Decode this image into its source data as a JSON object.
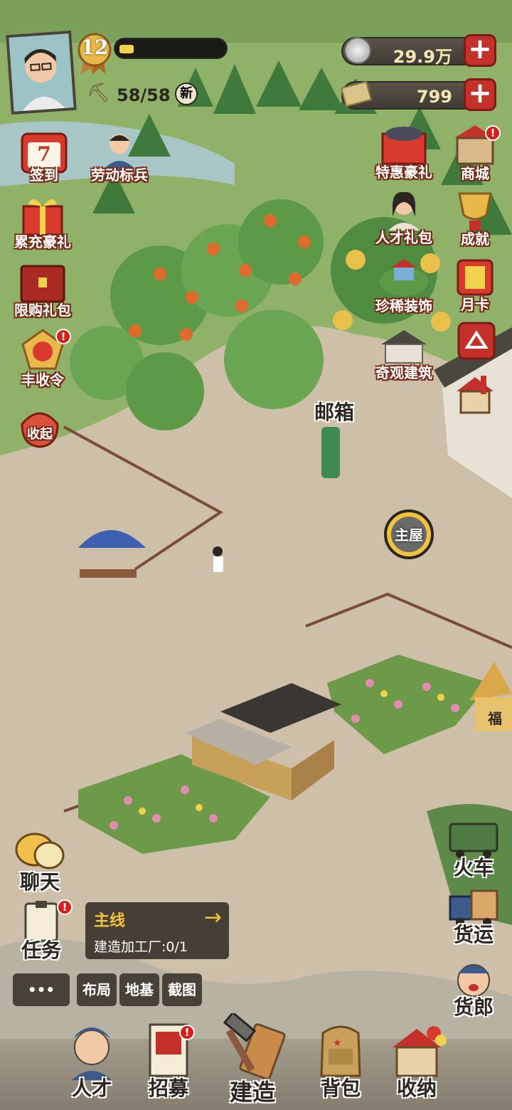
{
  "player": {
    "level": "12",
    "energy": "58/58",
    "new_tag": "新"
  },
  "currency": {
    "coins": "29.9万",
    "cash": "799"
  },
  "left_menu": [
    {
      "label": "签到",
      "day": "7",
      "icon": "calendar-icon"
    },
    {
      "label": "劳动标兵",
      "icon": "worker-icon"
    },
    {
      "label": "累充豪礼",
      "icon": "gift-box-icon"
    },
    {
      "label": "限购礼包",
      "icon": "chest-icon"
    },
    {
      "label": "丰收令",
      "icon": "harvest-medal-icon"
    },
    {
      "label": "收起",
      "icon": "collapse-icon"
    }
  ],
  "right_menu": [
    {
      "label": "特惠豪礼",
      "icon": "gift-icon"
    },
    {
      "label": "商城",
      "icon": "shop-icon"
    },
    {
      "label": "人才礼包",
      "icon": "talent-portrait-icon"
    },
    {
      "label": "成就",
      "icon": "trophy-icon"
    },
    {
      "label": "珍稀装饰",
      "icon": "decoration-icon"
    },
    {
      "label": "月卡",
      "icon": "month-card-icon"
    },
    {
      "label": "奇观建筑",
      "icon": "wonder-building-icon"
    }
  ],
  "map_labels": {
    "mailbox": "邮箱",
    "main_house": "主屋",
    "fu": "福"
  },
  "chat": {
    "label": "聊天"
  },
  "task": {
    "label": "任务"
  },
  "quest": {
    "title": "主线",
    "desc": "建造加工厂:0/1"
  },
  "tools": [
    "布局",
    "地基",
    "截图"
  ],
  "more_label": "•••",
  "right_bottom": [
    {
      "label": "火车",
      "icon": "train-icon"
    },
    {
      "label": "货运",
      "icon": "truck-icon"
    },
    {
      "label": "货郎",
      "icon": "peddler-icon"
    }
  ],
  "bottom_nav": [
    {
      "label": "人才",
      "icon": "worker-avatar-icon"
    },
    {
      "label": "招募",
      "icon": "recruit-poster-icon"
    },
    {
      "label": "建造",
      "icon": "hammer-icon"
    },
    {
      "label": "背包",
      "icon": "backpack-icon"
    },
    {
      "label": "收纳",
      "icon": "storage-house-icon"
    }
  ],
  "colors": {
    "ground": "#cdbfa8",
    "grass": "#8fb168",
    "river": "#a9c6c6",
    "accent_red": "#c4312a",
    "gold": "#e8b84a"
  }
}
